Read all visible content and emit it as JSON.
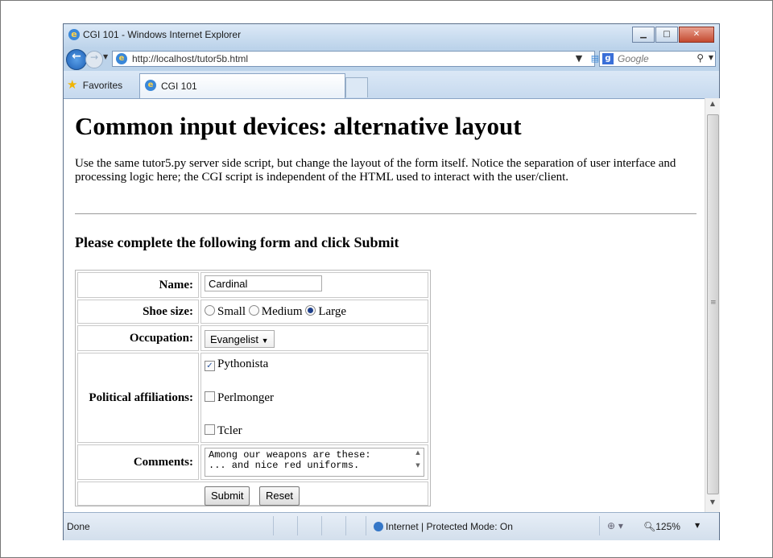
{
  "window": {
    "title": "CGI 101 - Windows Internet Explorer"
  },
  "nav": {
    "url": "http://localhost/tutor5b.html",
    "search_placeholder": "Google"
  },
  "favbar": {
    "favorites_label": "Favorites",
    "tab_label": "CGI 101"
  },
  "page": {
    "title": "Common input devices: alternative layout",
    "description": "Use the same tutor5.py server side script, but change the layout of the form itself. Notice the separation of user interface and processing logic here; the CGI script is independent of the HTML used to interact with the user/client.",
    "form_heading": "Please complete the following form and click Submit"
  },
  "form": {
    "name_label": "Name:",
    "name_value": "Cardinal",
    "shoe_label": "Shoe size:",
    "shoe_options": [
      "Small",
      "Medium",
      "Large"
    ],
    "shoe_selected": "Large",
    "occupation_label": "Occupation:",
    "occupation_value": "Evangelist",
    "political_label": "Political affiliations:",
    "political_options": [
      {
        "label": "Pythonista",
        "checked": true
      },
      {
        "label": "Perlmonger",
        "checked": false
      },
      {
        "label": "Tcler",
        "checked": false
      }
    ],
    "comments_label": "Comments:",
    "comments_line1": "Among our weapons are these:",
    "comments_line2": "... and nice red uniforms.",
    "submit_label": "Submit",
    "reset_label": "Reset"
  },
  "status": {
    "left": "Done",
    "zone": "Internet | Protected Mode: On",
    "zoom": "125%"
  }
}
